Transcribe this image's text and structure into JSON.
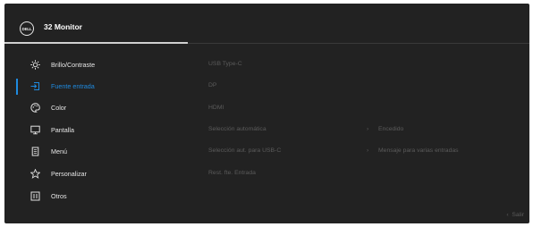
{
  "header": {
    "logo_text": "DELL",
    "title": "32 Monitor"
  },
  "menu": {
    "items": [
      {
        "label": "Brillo/Contraste",
        "icon": "sun-icon",
        "active": false
      },
      {
        "label": "Fuente entrada",
        "icon": "input-icon",
        "active": true
      },
      {
        "label": "Color",
        "icon": "palette-icon",
        "active": false
      },
      {
        "label": "Pantalla",
        "icon": "monitor-icon",
        "active": false
      },
      {
        "label": "Menú",
        "icon": "menu-icon",
        "active": false
      },
      {
        "label": "Personalizar",
        "icon": "star-icon",
        "active": false
      },
      {
        "label": "Otros",
        "icon": "other-icon",
        "active": false
      }
    ]
  },
  "options": {
    "items": [
      {
        "label": "USB Type-C"
      },
      {
        "label": "DP"
      },
      {
        "label": "HDMI"
      },
      {
        "label": "Selección automática",
        "value": "Encedido"
      },
      {
        "label": "Selección aut. para USB-C",
        "value": "Mensaje para varias entradas"
      },
      {
        "label": "Rest. fte. Entrada"
      }
    ]
  },
  "footer": {
    "exit_label": "Salir"
  },
  "colors": {
    "accent": "#1f8be0",
    "background": "#222222",
    "inactive_text": "#5b5b5b"
  }
}
